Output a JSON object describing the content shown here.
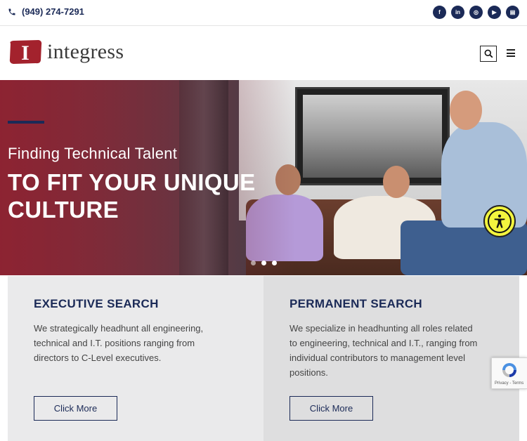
{
  "topbar": {
    "phone": "(949) 274-7291",
    "socials": [
      {
        "icon": "facebook-icon",
        "glyph": "f"
      },
      {
        "icon": "linkedin-icon",
        "glyph": "in"
      },
      {
        "icon": "instagram-icon",
        "glyph": "◎"
      },
      {
        "icon": "youtube-icon",
        "glyph": "▶"
      },
      {
        "icon": "blog-icon",
        "glyph": "▤"
      }
    ]
  },
  "header": {
    "logo_letter": "I",
    "logo_text": "integress"
  },
  "hero": {
    "subtitle": "Finding Technical Talent",
    "title": "TO FIT YOUR UNIQUE CULTURE",
    "slides": 3,
    "active_slide": 1
  },
  "cards": [
    {
      "title": "EXECUTIVE SEARCH",
      "body": "We strategically headhunt all engineering, technical and I.T. positions ranging from directors to C-Level executives.",
      "button": "Click More"
    },
    {
      "title": "PERMANENT SEARCH",
      "body": "We specialize in headhunting all roles related to engineering, technical and I.T., ranging from individual contributors to management level positions.",
      "button": "Click More"
    }
  ],
  "recaptcha": {
    "text": "Privacy - Terms"
  },
  "colors": {
    "navy": "#1b2a57",
    "brand_red": "#8f2432",
    "a11y_yellow": "#f3f53e"
  }
}
